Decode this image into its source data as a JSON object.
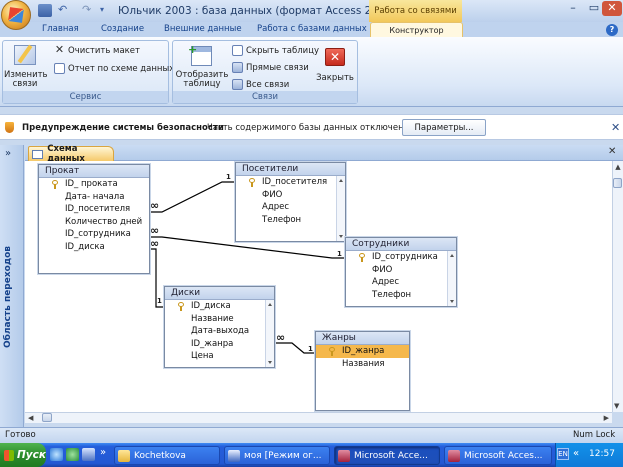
{
  "title": "Юльчик 2003 : база данных (формат Access 200...",
  "context_tab_title": "Работа со связями",
  "tabs": [
    "Главная",
    "Создание",
    "Внешние данные",
    "Работа с базами данных",
    "Конструктор"
  ],
  "ribbon": {
    "edit_links": "Изменить\nсвязи",
    "clear_layout": "Очистить макет",
    "schema_report": "Отчет по схеме данных",
    "group_service": "Сервис",
    "show_table": "Отобразить\nтаблицу",
    "hide_table": "Скрыть таблицу",
    "direct_links": "Прямые связи",
    "all_links": "Все связи",
    "close": "Закрыть",
    "group_links": "Связи"
  },
  "security": {
    "title": "Предупреждение системы безопасности",
    "message": "Часть содержимого базы данных отключено",
    "button": "Параметры..."
  },
  "nav_pane_label": "Область переходов",
  "doc_tab": "Схема данных",
  "tables": {
    "prokat": {
      "title": "Прокат",
      "fields": [
        "ID_ проката",
        "Дата- начала",
        "ID_посетителя",
        "Количество дней",
        "ID_сотрудника",
        "ID_диска"
      ]
    },
    "posetiteli": {
      "title": "Посетители",
      "fields": [
        "ID_посетителя",
        "ФИО",
        "Адрес",
        "Телефон"
      ]
    },
    "sotrudniki": {
      "title": "Сотрудники",
      "fields": [
        "ID_сотрудника",
        "ФИО",
        "Адрес",
        "Телефон"
      ]
    },
    "diski": {
      "title": "Диски",
      "fields": [
        "ID_диска",
        "Название",
        "Дата-выхода",
        "ID_жанра",
        "Цена"
      ]
    },
    "zhanry": {
      "title": "Жанры",
      "fields": [
        "ID_жанра",
        "Названия"
      ]
    }
  },
  "rel_labels": {
    "one": "1",
    "many": "∞"
  },
  "status": {
    "left": "Готово",
    "right": "Num Lock"
  },
  "taskbar": {
    "start": "Пуск",
    "items": [
      "Kochetkova",
      "моя [Режим ог...",
      "Microsoft Acce...",
      "Microsoft Acces..."
    ],
    "lang": "EN",
    "clock": "12:57"
  }
}
